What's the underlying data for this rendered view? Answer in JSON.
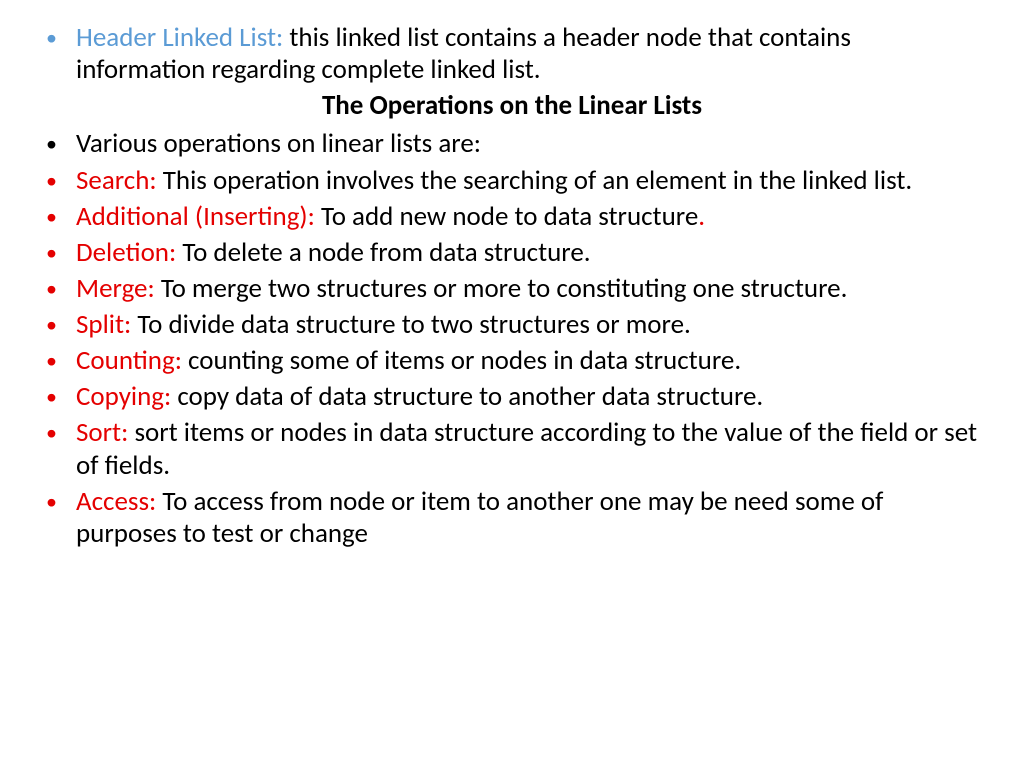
{
  "items": [
    {
      "termClass": "term-blue",
      "bulletClass": "bullet-blue",
      "term": "Header Linked List: ",
      "text": "this linked list contains a header node that contains information regarding complete linked list."
    }
  ],
  "heading": "The Operations on the Linear Lists",
  "intro": {
    "bulletClass": "bullet-black",
    "text": "Various operations on linear lists are:"
  },
  "ops": [
    {
      "term": "Search: ",
      "text": "This operation involves the searching of an element in the linked list."
    },
    {
      "term": "Additional (Inserting): ",
      "text": "To add new node to data structure",
      "trailingPeriod": "."
    },
    {
      "term": "Deletion: ",
      "text": "To delete a node from data structure."
    },
    {
      "term": "Merge: ",
      "text": "To merge two structures or more to constituting one structure."
    },
    {
      "term": "Split: ",
      "text": "To divide data structure to two structures or more."
    },
    {
      "term": "Counting: ",
      "text": "counting some of items or nodes in data structure."
    },
    {
      "term": "Copying: ",
      "text": "copy data of data structure to another data structure."
    },
    {
      "term": "Sort: ",
      "text": "sort items or nodes in data structure according to the value of the field or set of fields."
    },
    {
      "term": "Access: ",
      "text": "To access from node or item to another one may be need some of purposes to test or change"
    }
  ]
}
